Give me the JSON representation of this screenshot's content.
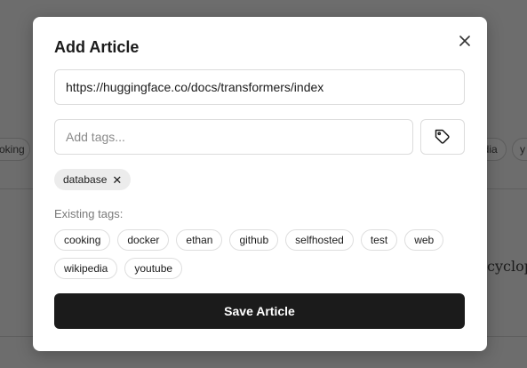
{
  "background": {
    "left_chip": "oking",
    "right_chip_1": "edia",
    "right_chip_2": "y",
    "right_text": "cyclop"
  },
  "modal": {
    "title": "Add Article",
    "url_value": "https://huggingface.co/docs/transformers/index",
    "tags_placeholder": "Add tags...",
    "selected_tags": [
      "database"
    ],
    "existing_label": "Existing tags:",
    "existing_tags": [
      "cooking",
      "docker",
      "ethan",
      "github",
      "selfhosted",
      "test",
      "web",
      "wikipedia",
      "youtube"
    ],
    "save_label": "Save Article"
  },
  "icons": {
    "close": "close-icon",
    "tag": "tag-icon",
    "remove": "remove-tag-icon"
  },
  "colors": {
    "primary_button": "#1b1b1b",
    "backdrop": "#6f6f6f"
  }
}
